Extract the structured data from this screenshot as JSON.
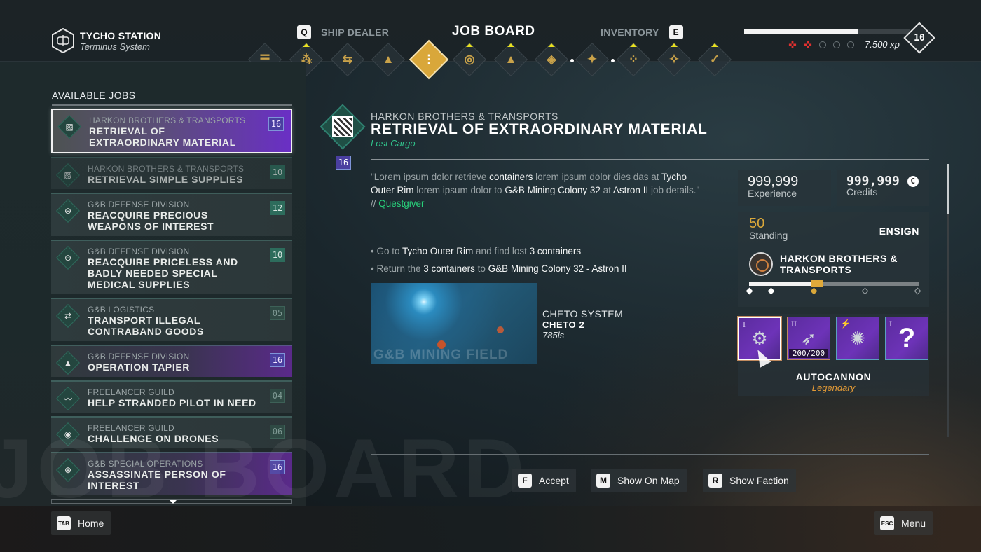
{
  "header": {
    "station_name": "TYCHO STATION",
    "station_system": "Terminus System",
    "tabs": [
      {
        "key": "Q",
        "label": "SHIP DEALER"
      },
      {
        "label": "JOB BOARD",
        "active": true
      },
      {
        "key": "E",
        "label": "INVENTORY"
      }
    ],
    "nav_icons": [
      {
        "name": "menu-list-icon",
        "glyph": "☰",
        "marker": false
      },
      {
        "name": "crew-icon",
        "glyph": "⁂",
        "marker": true
      },
      {
        "name": "trade-icon",
        "glyph": "⇆",
        "marker": false
      },
      {
        "name": "ship-exchange-icon",
        "glyph": "▲",
        "marker": false
      },
      {
        "name": "job-board-icon",
        "glyph": "⋮",
        "marker": false,
        "active": true
      },
      {
        "name": "storage-icon",
        "glyph": "◎",
        "marker": true
      },
      {
        "name": "ship-upgrade-icon",
        "glyph": "▲",
        "marker": true
      },
      {
        "name": "rank-icon",
        "glyph": "◈",
        "marker": true
      },
      {
        "name": "navigation-icon",
        "glyph": "✦",
        "marker": false
      },
      {
        "name": "module-icon",
        "glyph": "⁘",
        "marker": true
      },
      {
        "name": "blueprint-icon",
        "glyph": "✧",
        "marker": true
      },
      {
        "name": "missions-check-icon",
        "glyph": "✓",
        "marker": true
      }
    ],
    "xp": {
      "progress_fraction": 0.69,
      "value": "7.500 xp",
      "level": "10",
      "pips_filled": 2,
      "pips_total": 5,
      "pip_color": "#e03030"
    }
  },
  "jobs": {
    "title": "AVAILABLE JOBS",
    "items": [
      {
        "faction": "HARKON BROTHERS & TRANSPORTS",
        "title": "RETRIEVAL OF EXTRAORDINARY MATERIAL",
        "level": "16",
        "icon": "cargo-icon",
        "style": "selected"
      },
      {
        "faction": "HARKON BROTHERS & TRANSPORTS",
        "title": "RETRIEVAL SIMPLE SUPPLIES",
        "level": "10",
        "icon": "cargo-icon",
        "style": "dim"
      },
      {
        "faction": "G&B DEFENSE DIVISION",
        "title": "REACQUIRE PRECIOUS WEAPONS OF INTEREST",
        "level": "12",
        "icon": "reacquire-icon",
        "style": "normal"
      },
      {
        "faction": "G&B DEFENSE DIVISION",
        "title": "REACQUIRE PRICELESS AND BADLY NEEDED SPECIAL MEDICAL SUPPLIES",
        "level": "10",
        "icon": "reacquire-icon",
        "style": "normal"
      },
      {
        "faction": "G&B LOGISTICS",
        "title": "TRANSPORT ILLEGAL CONTRABAND GOODS",
        "level": "05",
        "icon": "transport-icon",
        "style": "lowlevel"
      },
      {
        "faction": "G&B DEFENSE DIVISION",
        "title": "OPERATION TAPIER",
        "level": "16",
        "icon": "operation-icon",
        "style": "purple"
      },
      {
        "faction": "FREELANCER GUILD",
        "title": "HELP STRANDED PILOT IN NEED",
        "level": "04",
        "icon": "rescue-icon",
        "style": "lowlevel"
      },
      {
        "faction": "FREELANCER GUILD",
        "title": "CHALLENGE ON DRONES",
        "level": "06",
        "icon": "drone-icon",
        "style": "lowlevel"
      },
      {
        "faction": "G&B SPECIAL OPERATIONS",
        "title": "ASSASSINATE PERSON OF INTEREST",
        "level": "16",
        "icon": "target-icon",
        "style": "purple"
      }
    ]
  },
  "watermark": "JOB BOARD",
  "detail": {
    "faction": "HARKON BROTHERS & TRANSPORTS",
    "title": "RETRIEVAL OF EXTRAORDINARY MATERIAL",
    "subtitle": "Lost Cargo",
    "level": "16",
    "description_parts": [
      {
        "t": "\"Lorem ipsum dolor retrieve ",
        "hl": false
      },
      {
        "t": "containers",
        "hl": true
      },
      {
        "t": " lorem ipsum dolor dies das at ",
        "hl": false
      },
      {
        "t": "Tycho Outer Rim",
        "hl": true
      },
      {
        "t": " lorem ipsum dolor to ",
        "hl": false
      },
      {
        "t": "G&B Mining Colony 32",
        "hl": true
      },
      {
        "t": " at ",
        "hl": false
      },
      {
        "t": "Astron II",
        "hl": true
      },
      {
        "t": " job details.\"",
        "hl": false
      }
    ],
    "questgiver_prefix": "// ",
    "questgiver": "Questgiver",
    "objectives": [
      [
        {
          "t": "Go to ",
          "hl": false
        },
        {
          "t": "Tycho Outer Rim",
          "hl": true
        },
        {
          "t": " and find lost ",
          "hl": false
        },
        {
          "t": "3 containers",
          "hl": true
        }
      ],
      [
        {
          "t": "Return the ",
          "hl": false
        },
        {
          "t": "3 containers",
          "hl": true
        },
        {
          "t": " to ",
          "hl": false
        },
        {
          "t": "G&B Mining Colony 32 - Astron II",
          "hl": true
        }
      ]
    ],
    "map": {
      "watermark": "G&B MINING FIELD",
      "system": "CHETO SYSTEM",
      "planet": "CHETO 2",
      "distance": "785ls"
    }
  },
  "rewards": {
    "experience_value": "999,999",
    "experience_label": "Experience",
    "credits_value": "999,999",
    "credits_label": "Credits",
    "credits_icon": "C",
    "standing_value": "50",
    "standing_label": "Standing",
    "rank": "ENSIGN",
    "faction_name": "HARKON BROTHERS & TRANSPORTS",
    "reputation_fraction": 0.4,
    "reputation_marker_fraction": 0.38,
    "reputation_ticks": [
      {
        "pos": 0.0,
        "state": "done"
      },
      {
        "pos": 0.13,
        "state": "done"
      },
      {
        "pos": 0.38,
        "state": "current"
      },
      {
        "pos": 0.68,
        "state": "open"
      },
      {
        "pos": 0.99,
        "state": "open"
      }
    ],
    "accent_color": "#d9a73a"
  },
  "loadout": {
    "slots": [
      {
        "tier": "I",
        "art": "autocannon-icon",
        "glyph": "⚙",
        "selected": true,
        "border": "orange"
      },
      {
        "tier": "II",
        "art": "missile-icon",
        "glyph": "➶",
        "count": "200/200",
        "border": "orange"
      },
      {
        "tier": "⚡",
        "art": "drone-module-icon",
        "glyph": "✺",
        "border": "blue"
      },
      {
        "tier": "I",
        "art": "unknown-icon",
        "glyph": "?",
        "border": "blue"
      }
    ],
    "selected_name": "AUTOCANNON",
    "selected_rarity": "Legendary"
  },
  "actions": [
    {
      "key": "F",
      "label": "Accept"
    },
    {
      "key": "M",
      "label": "Show On Map"
    },
    {
      "key": "R",
      "label": "Show Faction"
    }
  ],
  "footer": {
    "home_key": "TAB",
    "home_label": "Home",
    "menu_key": "ESC",
    "menu_label": "Menu"
  }
}
